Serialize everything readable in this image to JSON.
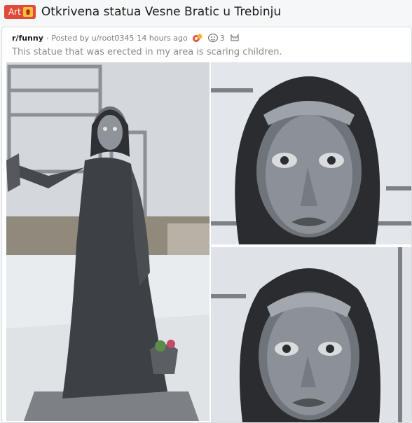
{
  "post": {
    "flair": {
      "label": "Art",
      "color": "#e14a3a",
      "icon": "emblem-icon"
    },
    "title": "Otkrivena statua Vesne Bratic u Trebinju"
  },
  "embedded_post": {
    "subreddit": "r/funny",
    "separator": "·",
    "posted_by": "Posted by u/root0345",
    "time_ago": "14 hours ago",
    "award_count": "3",
    "text": "This statue that was erected in my area is scaring children."
  },
  "images": [
    {
      "name": "full-statue-photo"
    },
    {
      "name": "statue-face-closeup-1"
    },
    {
      "name": "statue-face-closeup-2"
    }
  ]
}
